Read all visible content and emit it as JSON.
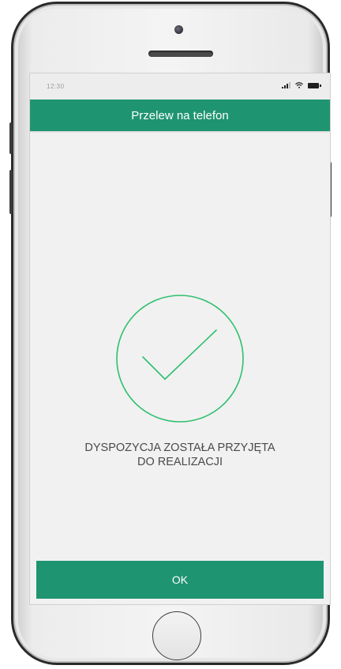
{
  "status_bar": {
    "time": "12:30"
  },
  "header": {
    "title": "Przelew na telefon"
  },
  "confirmation": {
    "icon": "checkmark-circle-icon",
    "message_line1": "DYSPOZYCJA ZOSTAŁA PRZYJĘTA",
    "message_line2": "DO REALIZACJI"
  },
  "actions": {
    "ok_label": "OK"
  },
  "colors": {
    "accent": "#1f9470",
    "success": "#2fbf6f",
    "background": "#f1f1f1"
  }
}
